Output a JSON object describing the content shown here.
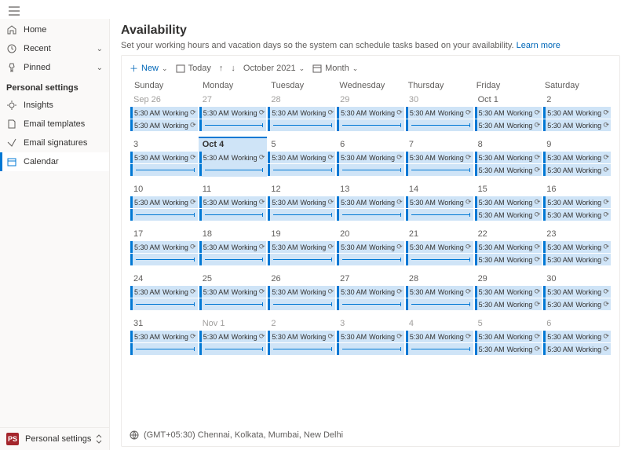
{
  "nav": {
    "home": "Home",
    "recent": "Recent",
    "pinned": "Pinned",
    "section": "Personal settings",
    "insights": "Insights",
    "email_templates": "Email templates",
    "email_signatures": "Email signatures",
    "calendar": "Calendar"
  },
  "footer": {
    "badge": "PS",
    "label": "Personal settings"
  },
  "page": {
    "title": "Availability",
    "subtitle": "Set your working hours and vacation days so the system can schedule tasks based on your availability.",
    "learn_more": "Learn more"
  },
  "toolbar": {
    "new": "New",
    "today": "Today",
    "period": "October 2021",
    "view": "Month"
  },
  "weekdays": [
    "Sunday",
    "Monday",
    "Tuesday",
    "Wednesday",
    "Thursday",
    "Friday",
    "Saturday"
  ],
  "event": {
    "time": "5:30 AM",
    "title": "Working"
  },
  "weeks": [
    [
      {
        "d": "Sep 26",
        "o": true,
        "e": 2
      },
      {
        "d": "27",
        "o": true,
        "e": 2
      },
      {
        "d": "28",
        "o": true,
        "e": 2
      },
      {
        "d": "29",
        "o": true,
        "e": 2
      },
      {
        "d": "30",
        "o": true,
        "e": 2
      },
      {
        "d": "Oct 1",
        "e": 2
      },
      {
        "d": "2",
        "e": 2
      }
    ],
    [
      {
        "d": "3",
        "e": 2
      },
      {
        "d": "Oct 4",
        "today": true,
        "e": 2
      },
      {
        "d": "5",
        "e": 2
      },
      {
        "d": "6",
        "e": 2
      },
      {
        "d": "7",
        "e": 2
      },
      {
        "d": "8",
        "e": 2
      },
      {
        "d": "9",
        "e": 2
      }
    ],
    [
      {
        "d": "10",
        "e": 2
      },
      {
        "d": "11",
        "e": 2
      },
      {
        "d": "12",
        "e": 2
      },
      {
        "d": "13",
        "e": 2
      },
      {
        "d": "14",
        "e": 2
      },
      {
        "d": "15",
        "e": 2
      },
      {
        "d": "16",
        "e": 2
      }
    ],
    [
      {
        "d": "17",
        "e": 2
      },
      {
        "d": "18",
        "e": 2
      },
      {
        "d": "19",
        "e": 2
      },
      {
        "d": "20",
        "e": 2
      },
      {
        "d": "21",
        "e": 2
      },
      {
        "d": "22",
        "e": 2
      },
      {
        "d": "23",
        "e": 2
      }
    ],
    [
      {
        "d": "24",
        "e": 2
      },
      {
        "d": "25",
        "e": 2
      },
      {
        "d": "26",
        "e": 2
      },
      {
        "d": "27",
        "e": 2
      },
      {
        "d": "28",
        "e": 2
      },
      {
        "d": "29",
        "e": 2
      },
      {
        "d": "30",
        "e": 2
      }
    ],
    [
      {
        "d": "31",
        "e": 2
      },
      {
        "d": "Nov 1",
        "o": true,
        "e": 2
      },
      {
        "d": "2",
        "o": true,
        "e": 2
      },
      {
        "d": "3",
        "o": true,
        "e": 2
      },
      {
        "d": "4",
        "o": true,
        "e": 2
      },
      {
        "d": "5",
        "o": true,
        "e": 2
      },
      {
        "d": "6",
        "o": true,
        "e": 2
      }
    ]
  ],
  "timezone": "(GMT+05:30) Chennai, Kolkata, Mumbai, New Delhi"
}
